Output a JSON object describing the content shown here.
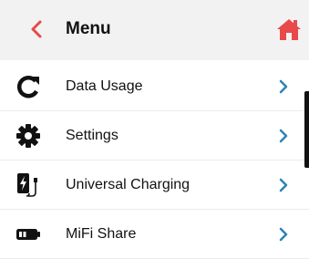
{
  "header": {
    "title": "Menu",
    "back_icon": "chevron-left-icon",
    "home_icon": "home-icon"
  },
  "colors": {
    "accent": "#e8494a",
    "chevron": "#2c84b4",
    "header_bg": "#f2f2f2"
  },
  "menu": {
    "items": [
      {
        "label": "Data Usage",
        "icon": "refresh-icon"
      },
      {
        "label": "Settings",
        "icon": "gear-icon"
      },
      {
        "label": "Universal Charging",
        "icon": "charging-phone-icon"
      },
      {
        "label": "MiFi Share",
        "icon": "battery-share-icon"
      }
    ]
  }
}
